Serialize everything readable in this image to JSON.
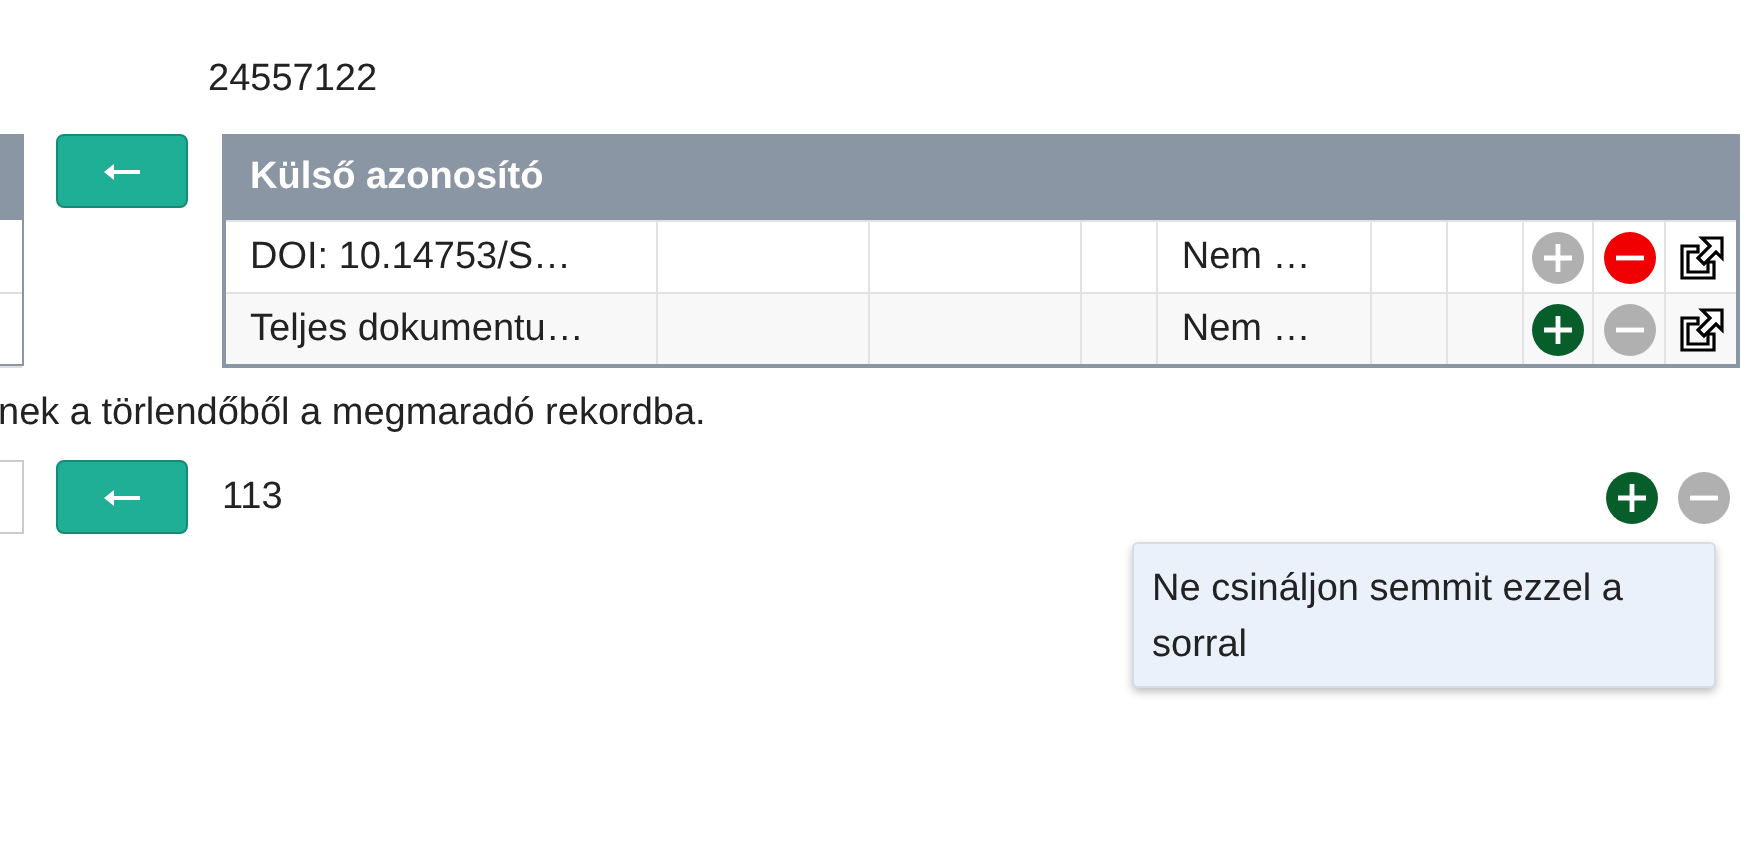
{
  "record_id": "24557122",
  "identifiers_table": {
    "header": "Külső azonosító",
    "rows": [
      {
        "identifier": "DOI: 10.14753/S…",
        "status": "Nem …",
        "plus_on": false,
        "minus_on": true
      },
      {
        "identifier": "Teljes dokumentu…",
        "status": "Nem …",
        "plus_on": true,
        "minus_on": false
      }
    ]
  },
  "note": "nek a törlendőből a megmaradó rekordba.",
  "count_row": {
    "value": "113",
    "plus_on": true,
    "minus_on": false
  },
  "tooltip": "Ne csináljon semmit ezzel a sorral"
}
